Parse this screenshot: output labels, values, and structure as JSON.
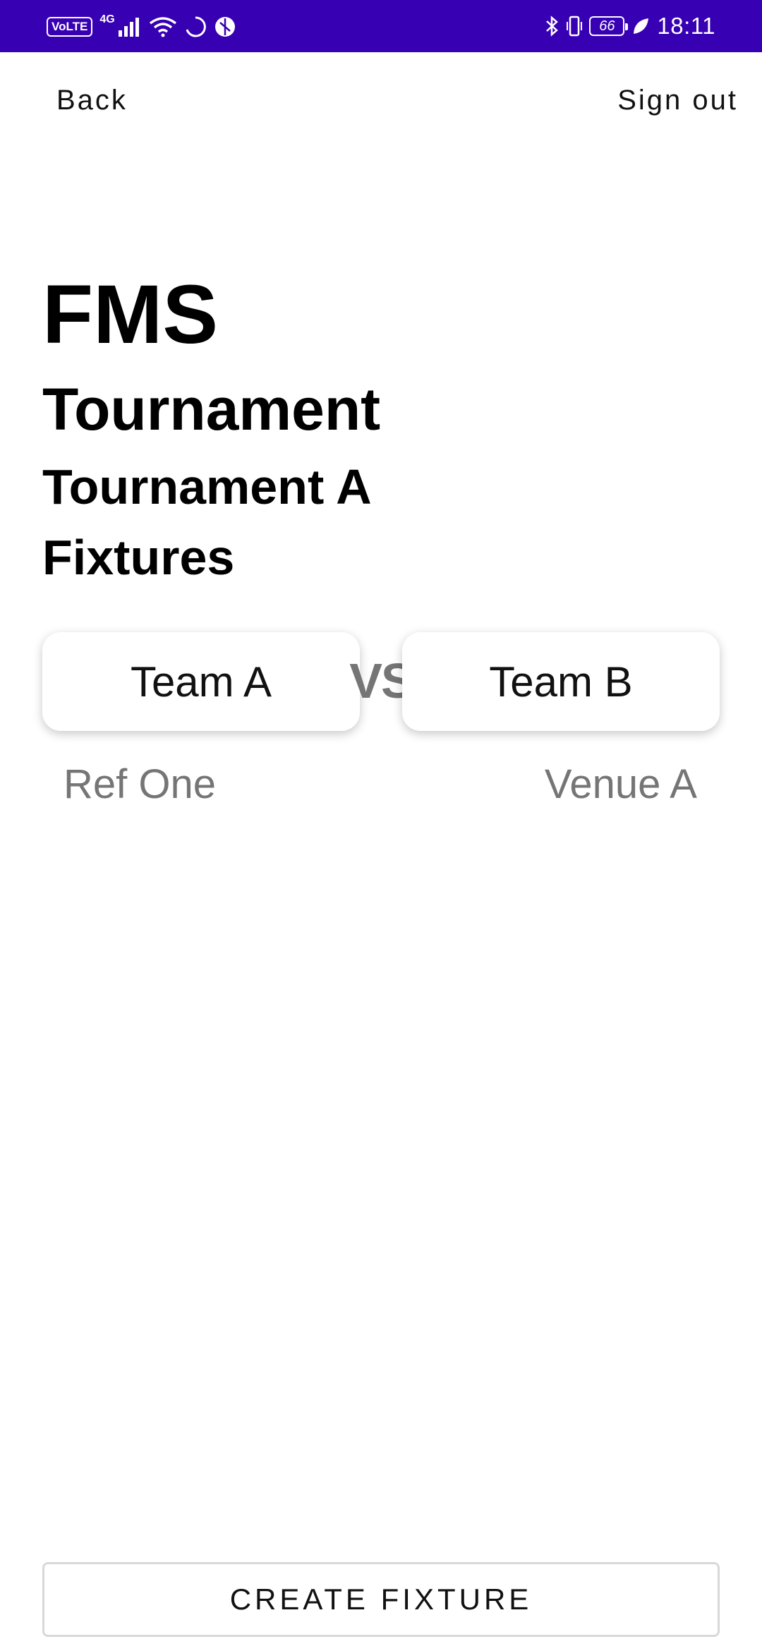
{
  "status_bar": {
    "volte": "VoLTE",
    "network": "4G",
    "icons_left": [
      "signal-icon",
      "wifi-icon",
      "loading-icon",
      "app-icon"
    ],
    "icons_right": [
      "bluetooth-icon",
      "vibrate-icon",
      "battery-icon",
      "leaf-icon"
    ],
    "battery_level": "66",
    "time": "18:11",
    "background_color": "#3700b3"
  },
  "nav": {
    "back_label": "Back",
    "signout_label": "Sign out"
  },
  "header": {
    "app_title": "FMS",
    "section_title": "Tournament",
    "tournament_name": "Tournament A",
    "fixtures_title": "Fixtures"
  },
  "fixture": {
    "team_a": "Team A",
    "vs": "VS",
    "team_b": "Team B",
    "referee": "Ref One",
    "venue": "Venue A"
  },
  "actions": {
    "create_fixture_label": "CREATE FIXTURE"
  },
  "colors": {
    "muted_text": "#757575"
  }
}
